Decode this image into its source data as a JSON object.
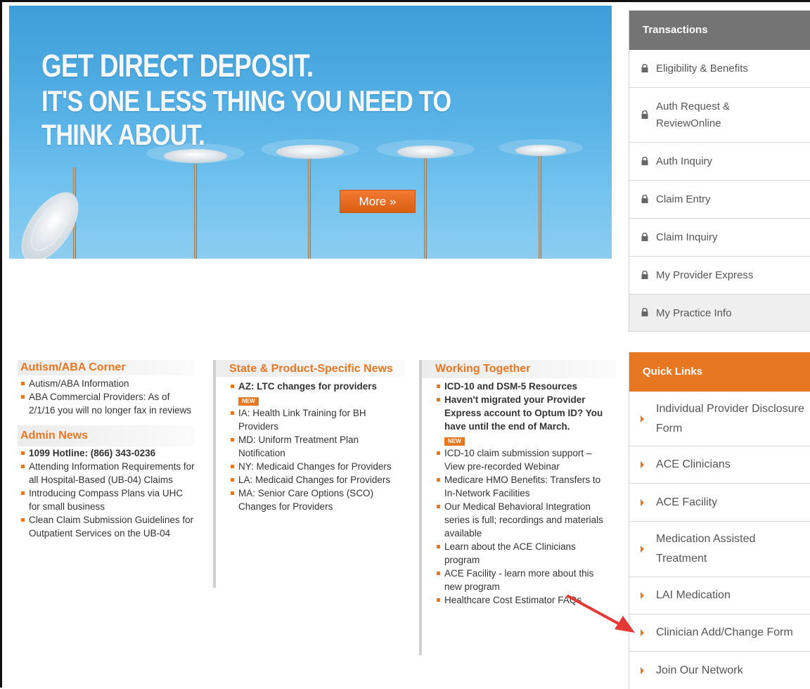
{
  "banner": {
    "headline": "GET DIRECT DEPOSIT.",
    "subheadline": "IT'S ONE LESS THING YOU NEED TO THINK ABOUT.",
    "more_label": "More »"
  },
  "transactions": {
    "title": "Transactions",
    "items": [
      {
        "label": "Eligibility & Benefits",
        "icon": "lock-icon"
      },
      {
        "label": "Auth Request & ReviewOnline",
        "icon": "lock-icon"
      },
      {
        "label": "Auth Inquiry",
        "icon": "lock-icon"
      },
      {
        "label": "Claim Entry",
        "icon": "lock-icon"
      },
      {
        "label": "Claim Inquiry",
        "icon": "lock-icon"
      },
      {
        "label": "My Provider Express",
        "icon": "lock-icon"
      },
      {
        "label": "My Practice Info",
        "icon": "lock-icon"
      }
    ]
  },
  "quick_links": {
    "title": "Quick Links",
    "items": [
      {
        "label": "Individual Provider Disclosure Form"
      },
      {
        "label": "ACE Clinicians"
      },
      {
        "label": "ACE Facility"
      },
      {
        "label": "Medication Assisted Treatment"
      },
      {
        "label": "LAI Medication"
      },
      {
        "label": "Clinician Add/Change Form"
      },
      {
        "label": "Join Our Network"
      }
    ]
  },
  "autism": {
    "title": "Autism/ABA Corner",
    "items": [
      "Autism/ABA Information",
      "ABA Commercial Providers: As of 2/1/16 you will no longer fax in reviews"
    ]
  },
  "admin": {
    "title": "Admin News",
    "items": [
      "1099 Hotline: (866) 343-0236",
      "Attending Information Requirements for all Hospital-Based (UB-04) Claims",
      "Introducing Compass Plans via UHC for small business",
      "Clean Claim Submission Guidelines for Outpatient Services on the UB-04"
    ]
  },
  "state": {
    "title": "State & Product-Specific News",
    "items": [
      "AZ: LTC changes for providers",
      "IA: Health Link Training for BH Providers",
      "MD: Uniform Treatment Plan Notification",
      "NY: Medicaid Changes for Providers",
      "LA: Medicaid Changes for Providers",
      "MA: Senior Care Options (SCO) Changes for Providers"
    ]
  },
  "working": {
    "title": "Working Together",
    "items": [
      "ICD-10 and DSM-5 Resources",
      "Haven't migrated your Provider Express account to Optum ID? You have until the end of March.",
      "ICD-10 claim submission support – View pre-recorded Webinar",
      "Medicare HMO Benefits: Transfers to In-Network Facilities",
      "Our Medical Behavioral Integration series is full; recordings and materials available",
      "Learn about the ACE Clinicians program",
      "ACE Facility - learn more about this new program",
      "Healthcare Cost Estimator FAQs"
    ]
  },
  "badges": {
    "new": "NEW"
  },
  "colors": {
    "accent": "#e87722",
    "panel_gray": "#747474",
    "annotation_arrow": "#e53935"
  }
}
